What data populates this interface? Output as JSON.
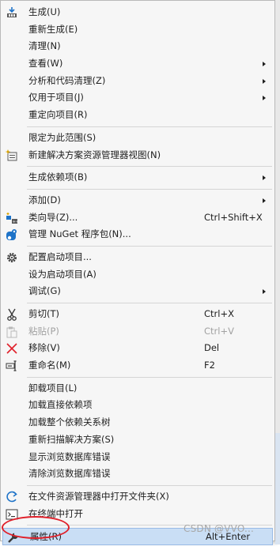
{
  "menu": {
    "groups": [
      [
        {
          "label": "生成(U)",
          "icon": "build-icon"
        },
        {
          "label": "重新生成(E)"
        },
        {
          "label": "清理(N)"
        },
        {
          "label": "查看(W)",
          "submenu": true
        },
        {
          "label": "分析和代码清理(Z)",
          "submenu": true
        },
        {
          "label": "仅用于项目(J)",
          "submenu": true
        },
        {
          "label": "重定向项目(R)"
        }
      ],
      [
        {
          "label": "限定为此范围(S)"
        },
        {
          "label": "新建解决方案资源管理器视图(N)",
          "icon": "new-view-icon"
        }
      ],
      [
        {
          "label": "生成依赖项(B)",
          "submenu": true
        }
      ],
      [
        {
          "label": "添加(D)",
          "submenu": true
        },
        {
          "label": "类向导(Z)...",
          "icon": "class-wizard-icon",
          "shortcut": "Ctrl+Shift+X"
        },
        {
          "label": "管理 NuGet 程序包(N)...",
          "icon": "nuget-icon"
        }
      ],
      [
        {
          "label": "配置启动项目...",
          "icon": "gear-icon"
        },
        {
          "label": "设为启动项目(A)"
        },
        {
          "label": "调试(G)",
          "submenu": true
        }
      ],
      [
        {
          "label": "剪切(T)",
          "icon": "scissors-icon",
          "shortcut": "Ctrl+X"
        },
        {
          "label": "粘贴(P)",
          "icon": "paste-icon",
          "shortcut": "Ctrl+V",
          "disabled": true
        },
        {
          "label": "移除(V)",
          "icon": "remove-icon",
          "shortcut": "Del"
        },
        {
          "label": "重命名(M)",
          "icon": "rename-icon",
          "shortcut": "F2"
        }
      ],
      [
        {
          "label": "卸载项目(L)"
        },
        {
          "label": "加载直接依赖项"
        },
        {
          "label": "加载整个依赖关系树"
        },
        {
          "label": "重新扫描解决方案(S)"
        },
        {
          "label": "显示浏览数据库错误"
        },
        {
          "label": "清除浏览数据库错误"
        }
      ],
      [
        {
          "label": "在文件资源管理器中打开文件夹(X)",
          "icon": "open-folder-icon"
        },
        {
          "label": "在终端中打开",
          "icon": "terminal-icon"
        }
      ],
      [
        {
          "label": "属性(R)",
          "icon": "wrench-icon",
          "shortcut": "Alt+Enter",
          "selected": true
        }
      ]
    ]
  },
  "watermark": "CSDN @VVO...",
  "colors": {
    "menu_bg": "#f6f6f6",
    "selected_bg": "#c9def5",
    "annotation_red": "#e0202a",
    "disabled_text": "#a2a2a2"
  }
}
